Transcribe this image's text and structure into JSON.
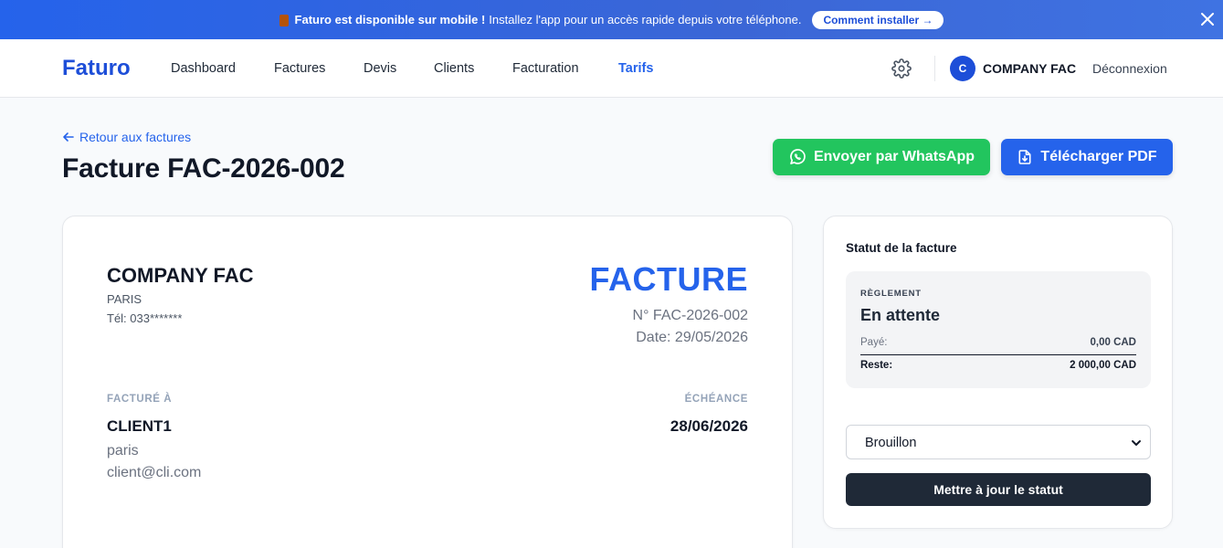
{
  "banner": {
    "title": "Faturo est disponible sur mobile !",
    "text": "Installez l'app pour un accès rapide depuis votre téléphone.",
    "button": "Comment installer →"
  },
  "nav": {
    "logo": "Faturo",
    "items": [
      "Dashboard",
      "Factures",
      "Devis",
      "Clients",
      "Facturation",
      "Tarifs"
    ],
    "active": "Tarifs",
    "avatar_initial": "C",
    "company": "COMPANY FAC",
    "logout": "Déconnexion"
  },
  "header": {
    "back": "Retour aux factures",
    "title": "Facture FAC-2026-002",
    "whatsapp_button": "Envoyer par WhatsApp",
    "pdf_button": "Télécharger PDF"
  },
  "invoice": {
    "from_name": "COMPANY FAC",
    "from_city": "PARIS",
    "from_tel": "Tél: 033*******",
    "doc_type": "FACTURE",
    "number": "N° FAC-2026-002",
    "date": "Date: 29/05/2026",
    "billto_label": "FACTURÉ À",
    "client_name": "CLIENT1",
    "client_city": "paris",
    "client_email": "client@cli.com",
    "due_label": "ÉCHÉANCE",
    "due_date": "28/06/2026"
  },
  "status": {
    "title": "Statut de la facture",
    "settlement_label": "RÈGLEMENT",
    "settlement_status": "En attente",
    "paid_label": "Payé:",
    "paid_value": "0,00 CAD",
    "rest_label": "Reste:",
    "rest_value": "2 000,00 CAD",
    "select_value": "Brouillon",
    "update_button": "Mettre à jour le statut"
  },
  "colors": {
    "primary": "#2563eb",
    "whatsapp": "#22c55e",
    "dark": "#1f2937"
  }
}
